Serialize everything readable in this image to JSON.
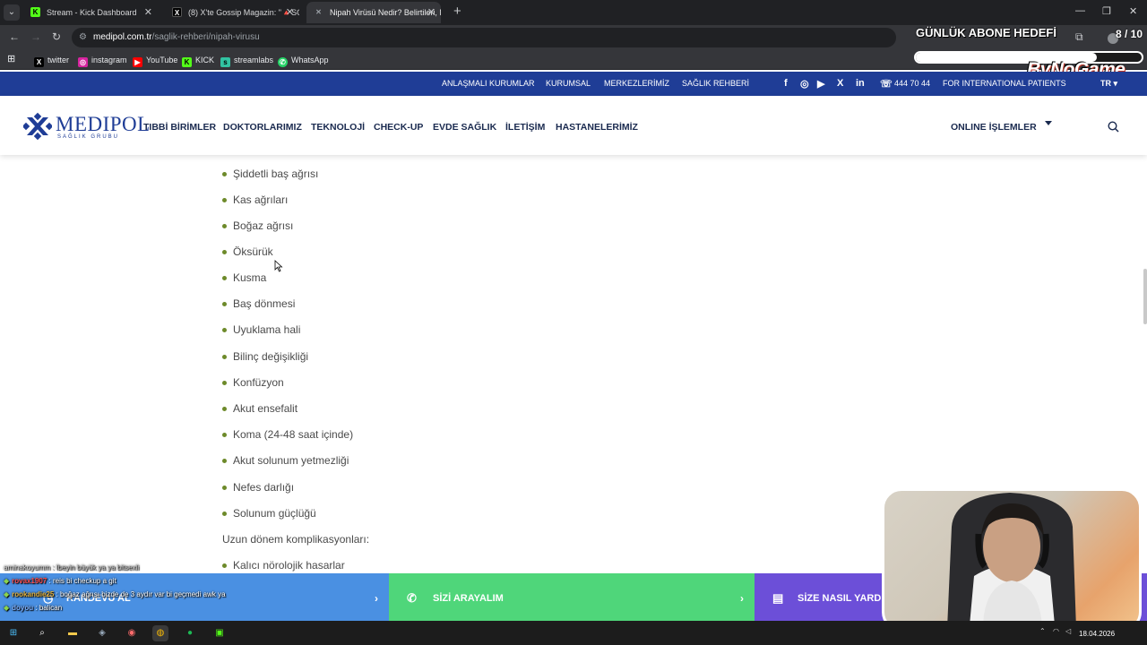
{
  "browser": {
    "tabs": [
      {
        "label": "Stream - Kick Dashboard",
        "favicon_color": "#53fc18",
        "favicon": "K"
      },
      {
        "label": "(8) X'te Gossip Magazin: \"🔺SO",
        "favicon_color": "#ffffff",
        "favicon": "X"
      },
      {
        "label": "Nipah Virüsü Nedir? Belirtileri, N",
        "favicon_color": "#9aa0a6",
        "favicon": "✕"
      }
    ],
    "url_host": "medipol.com.tr",
    "url_path": "/saglik-rehberi/nipah-virusu",
    "bookmarks": [
      "twitter",
      "instagram",
      "YouTube",
      "KICK",
      "streamlabs",
      "WhatsApp"
    ]
  },
  "overlay": {
    "title": "GÜNLÜK ABONE HEDEFİ",
    "count": "8 / 10",
    "progress": 0.8,
    "brand": "ByNoGame"
  },
  "site": {
    "topstrip": {
      "links": [
        "ANLAŞMALI KURUMLAR",
        "KURUMSAL",
        "MERKEZLERİMİZ",
        "SAĞLIK REHBERİ"
      ],
      "phone": "444 70 44",
      "intl": "FOR INTERNATIONAL PATIENTS",
      "lang": "TR"
    },
    "logo": {
      "name": "MEDIPOL",
      "sub": "SAĞLIK GRUBU"
    },
    "menu": [
      "TIBBİ BİRİMLER",
      "DOKTORLARIMIZ",
      "TEKNOLOJİ",
      "CHECK-UP",
      "EVDE SAĞLIK",
      "İLETİŞİM",
      "HASTANELERİMİZ"
    ],
    "online": "ONLINE İŞLEMLER"
  },
  "content": {
    "symptoms": [
      "Şiddetli baş ağrısı",
      "Kas ağrıları",
      "Boğaz ağrısı",
      "Öksürük",
      "Kusma",
      "Baş dönmesi",
      "Uyuklama hali",
      "Bilinç değişikliği",
      "Konfüzyon",
      "Akut ensefalit",
      "Koma (24-48 saat içinde)",
      "Akut solunum yetmezliği",
      "Nefes darlığı",
      "Solunum güçlüğü"
    ],
    "long_term_heading": "Uzun dönem komplikasyonları:",
    "long_term": [
      "Kalıcı nörolojik hasarlar"
    ]
  },
  "cta": {
    "appointment": "RANDEVU AL",
    "call_us": "SİZİ ARAYALIM",
    "help": "SİZE NASIL YARD"
  },
  "chat": [
    {
      "user": "aminakoyumm",
      "msg": ": lbeyin büyük ya ya bitsexli"
    },
    {
      "user": "rovax1907",
      "msg": ": reis bi checkup a git"
    },
    {
      "user": "rookandie25",
      "msg": ": boğaz ağrısı bizde de 3 aydır var bi geçmedi awk ya"
    },
    {
      "user": "doyou",
      "msg": ": balican"
    }
  ],
  "taskbar": {
    "date": "18.04.2026"
  },
  "colors": {
    "brand_blue": "#1f3d96",
    "cta_blue": "#4a90e2",
    "cta_green": "#4fd67a",
    "cta_purple": "#6c4fd8",
    "bullet_green": "#6d8a2a"
  }
}
